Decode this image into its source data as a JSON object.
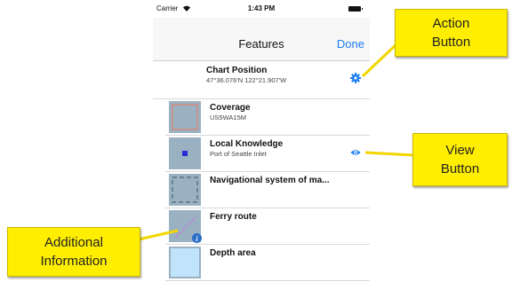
{
  "status_bar": {
    "carrier": "Carrier",
    "time": "1:43 PM"
  },
  "nav": {
    "title": "Features",
    "done_label": "Done"
  },
  "rows": [
    {
      "title": "Chart Position",
      "subtitle": "47°36.076'N 122°21.907'W",
      "action_icon": "gear-icon"
    },
    {
      "title": "Coverage",
      "subtitle": "US5WA15M"
    },
    {
      "title": "Local Knowledge",
      "subtitle": "Port of Seattle Inlet",
      "action_icon": "eye-icon"
    },
    {
      "title": "Navigational system of ma...",
      "subtitle": ""
    },
    {
      "title": "Ferry route",
      "subtitle": "",
      "badge_icon": "info-icon"
    },
    {
      "title": "Depth area",
      "subtitle": ""
    }
  ],
  "callouts": {
    "action": [
      "Action",
      "Button"
    ],
    "view": [
      "View",
      "Button"
    ],
    "info": [
      "Additional",
      "Information"
    ]
  },
  "colors": {
    "accent": "#1a7cf2",
    "callout": "#ffee00",
    "thumb": "#9ab1c1"
  }
}
